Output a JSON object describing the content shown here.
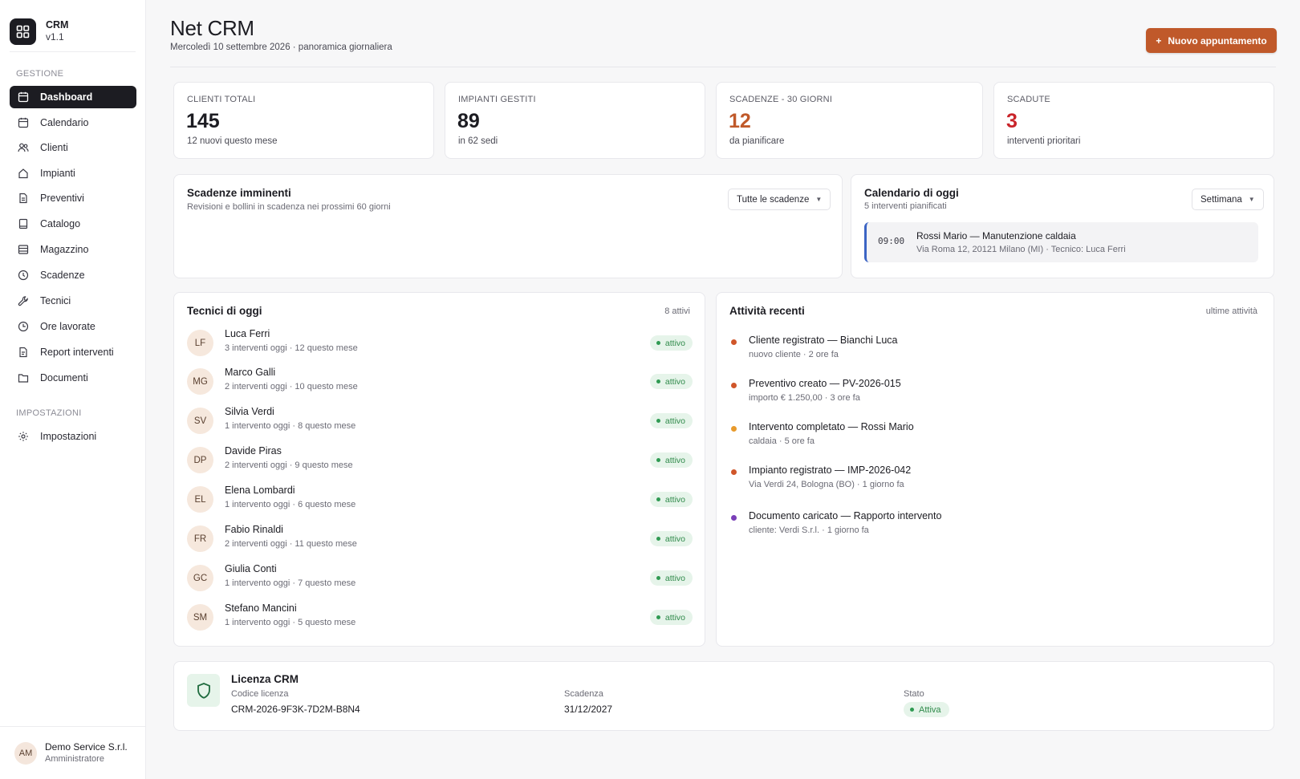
{
  "brand": {
    "name": "CRM",
    "version": "v1.1"
  },
  "sidebar": {
    "section_management": "GESTIONE",
    "section_settings": "IMPOSTAZIONI",
    "items": [
      {
        "label": "Dashboard",
        "icon": "dashboard-icon"
      },
      {
        "label": "Calendario",
        "icon": "calendar-icon"
      },
      {
        "label": "Clienti",
        "icon": "users-icon"
      },
      {
        "label": "Impianti",
        "icon": "home-icon"
      },
      {
        "label": "Preventivi",
        "icon": "document-icon"
      },
      {
        "label": "Catalogo",
        "icon": "book-icon"
      },
      {
        "label": "Magazzino",
        "icon": "warehouse-icon"
      },
      {
        "label": "Scadenze",
        "icon": "clock-alert-icon"
      },
      {
        "label": "Tecnici",
        "icon": "wrench-icon"
      },
      {
        "label": "Ore lavorate",
        "icon": "clock-icon"
      },
      {
        "label": "Report interventi",
        "icon": "report-icon"
      },
      {
        "label": "Documenti",
        "icon": "folder-icon"
      }
    ],
    "settings_item": {
      "label": "Impostazioni",
      "icon": "gear-icon"
    },
    "footer": {
      "initials": "AM",
      "company": "Demo Service S.r.l.",
      "role": "Amministratore"
    }
  },
  "header": {
    "title": "Net CRM",
    "subtitle": "Mercoledì 10 settembre 2026 · panoramica giornaliera",
    "new_button": "Nuovo appuntamento",
    "new_button_icon": "+"
  },
  "kpis": [
    {
      "label": "CLIENTI TOTALI",
      "value": "145",
      "sub": "12 nuovi questo mese"
    },
    {
      "label": "IMPIANTI GESTITI",
      "value": "89",
      "sub": "in 62 sedi"
    },
    {
      "label": "SCADENZE - 30 GIORNI",
      "value": "12",
      "sub": "da pianificare"
    },
    {
      "label": "SCADUTE",
      "value": "3",
      "sub": "interventi prioritari"
    }
  ],
  "deadlines": {
    "title": "Scadenze imminenti",
    "subtitle": "Revisioni e bollini in scadenza nei prossimi  60 giorni",
    "filter": "Tutte le scadenze"
  },
  "calendar": {
    "title": "Calendario di oggi",
    "subtitle": "5 interventi pianificati",
    "view": "Settimana",
    "appointment": {
      "time": "09:00",
      "title": "Rossi Mario — Manutenzione caldaia",
      "details": "Via Roma 12, 20121 Milano (MI) · Tecnico: Luca Ferri"
    }
  },
  "technicians": {
    "title": "Tecnici di oggi",
    "count": "8 attivi",
    "items": [
      {
        "initials": "LF",
        "name": "Luca Ferri",
        "stats": "3 interventi oggi · 12 questo mese",
        "status": "attivo"
      },
      {
        "initials": "MG",
        "name": "Marco Galli",
        "stats": "2 interventi oggi · 10 questo mese",
        "status": "attivo"
      },
      {
        "initials": "SV",
        "name": "Silvia Verdi",
        "stats": "1 intervento oggi · 8 questo mese",
        "status": "attivo"
      },
      {
        "initials": "DP",
        "name": "Davide Piras",
        "stats": "2 interventi oggi · 9 questo mese",
        "status": "attivo"
      },
      {
        "initials": "EL",
        "name": "Elena Lombardi",
        "stats": "1 intervento oggi · 6 questo mese",
        "status": "attivo"
      },
      {
        "initials": "FR",
        "name": "Fabio Rinaldi",
        "stats": "2 interventi oggi · 11 questo mese",
        "status": "attivo"
      },
      {
        "initials": "GC",
        "name": "Giulia Conti",
        "stats": "1 intervento oggi · 7 questo mese",
        "status": "attivo"
      },
      {
        "initials": "SM",
        "name": "Stefano Mancini",
        "stats": "1 intervento oggi · 5 questo mese",
        "status": "attivo"
      }
    ]
  },
  "activity": {
    "title": "Attività recenti",
    "filter": "ultime attività",
    "items": [
      {
        "title": "Cliente registrato — Bianchi Luca",
        "meta": "nuovo cliente · 2 ore fa",
        "color": "#d0562a"
      },
      {
        "title": "Preventivo creato — PV-2026-015",
        "meta": "importo € 1.250,00 · 3 ore fa",
        "color": "#d0562a"
      },
      {
        "title": "Intervento completato — Rossi Mario",
        "meta": "caldaia · 5 ore fa",
        "color": "#e89a2c"
      },
      {
        "title": "Impianto registrato — IMP-2026-042",
        "meta": "Via Verdi 24, Bologna (BO) · 1 giorno fa",
        "color": "#d0562a"
      },
      {
        "title": "Documento caricato — Rapporto intervento",
        "meta": "cliente: Verdi S.r.l.  · 1 giorno fa",
        "color": "#7a3fb8"
      }
    ]
  },
  "license": {
    "title": "Licenza CRM",
    "code_label": "Codice licenza",
    "code": "CRM-2026-9F3K-7D2M-B8N4",
    "expiry_label": "Scadenza",
    "expiry": "31/12/2027",
    "status_label": "Stato",
    "status": "Attiva"
  },
  "colors": {
    "accent": "#c0592a",
    "danger": "#c9242a",
    "success": "#2f8a4a",
    "dark": "#1c1c22"
  }
}
